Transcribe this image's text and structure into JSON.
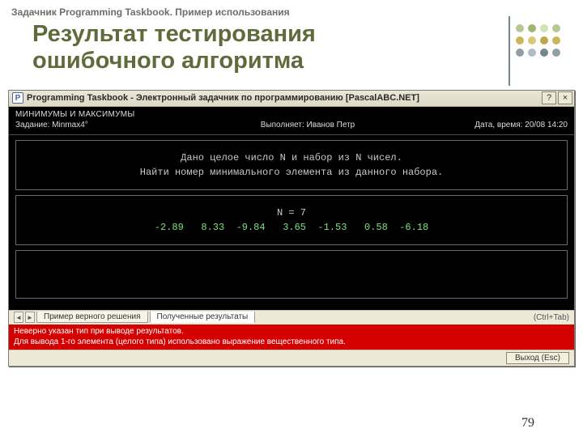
{
  "slide": {
    "header": "Задачник Programming Taskbook. Пример использования",
    "title_line1": "Результат тестирования",
    "title_line2": "ошибочного алгоритма",
    "page_number": "79"
  },
  "window": {
    "title": "Programming Taskbook - Электронный задачник по программированию [PascalABC.NET]",
    "help_btn": "?",
    "close_btn": "×",
    "section": "МИНИМУМЫ И МАКСИМУМЫ",
    "task_label": "Задание: Minmax4°",
    "executor_label": "Выполняет: Иванов Петр",
    "datetime_label": "Дата, время: 20/08 14:20",
    "problem": {
      "line1": "Дано целое число N и набор из N чисел.",
      "line2": "Найти номер минимального элемента из данного набора."
    },
    "data": {
      "n_label": "N = 7",
      "values": "-2.89   8.33  -9.84   3.65  -1.53   0.58  -6.18"
    },
    "tabs": {
      "prev": "◄",
      "next": "►",
      "tab1": "Пример верного решения",
      "tab2": "Полученные результаты",
      "shortcut": "(Ctrl+Tab)"
    },
    "error": {
      "line1": "Неверно указан тип при выводе результатов.",
      "line2": "Для вывода 1-го элемента (целого типа) использовано выражение вещественного типа."
    },
    "exit_btn": "Выход (Esc)"
  }
}
